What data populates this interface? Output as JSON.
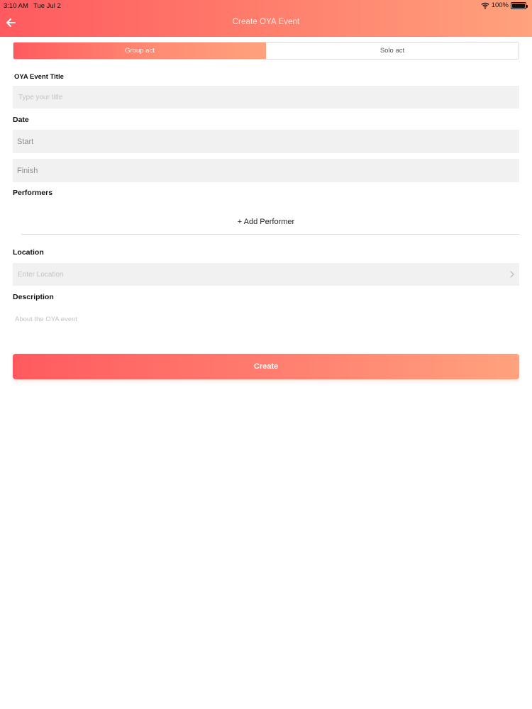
{
  "status_bar": {
    "time": "3:10 AM",
    "date": "Tue Jul 2",
    "battery": "100%",
    "icons": [
      "wifi-icon",
      "battery-icon"
    ]
  },
  "header": {
    "title": "Create OYA Event",
    "back_icon": "arrow-left-icon"
  },
  "segment": {
    "options": [
      "Group act",
      "Solo act"
    ],
    "selected": "Group act"
  },
  "form": {
    "title_label": "OYA Event Title",
    "title_placeholder": "Type your title",
    "date_label": "Date",
    "start_label": "Start",
    "finish_label": "Finish",
    "performers_label": "Performers",
    "add_performer": "+ Add Performer",
    "location_label": "Location",
    "location_placeholder": "Enter Location",
    "location_icon": "chevron-right-icon",
    "description_label": "Description",
    "description_placeholder": "About the OYA event"
  },
  "actions": {
    "create_label": "Create"
  },
  "colors": {
    "gradient_start": "#ff5a5f",
    "gradient_end": "#ffa27d",
    "field_background": "#f1f1f2"
  }
}
